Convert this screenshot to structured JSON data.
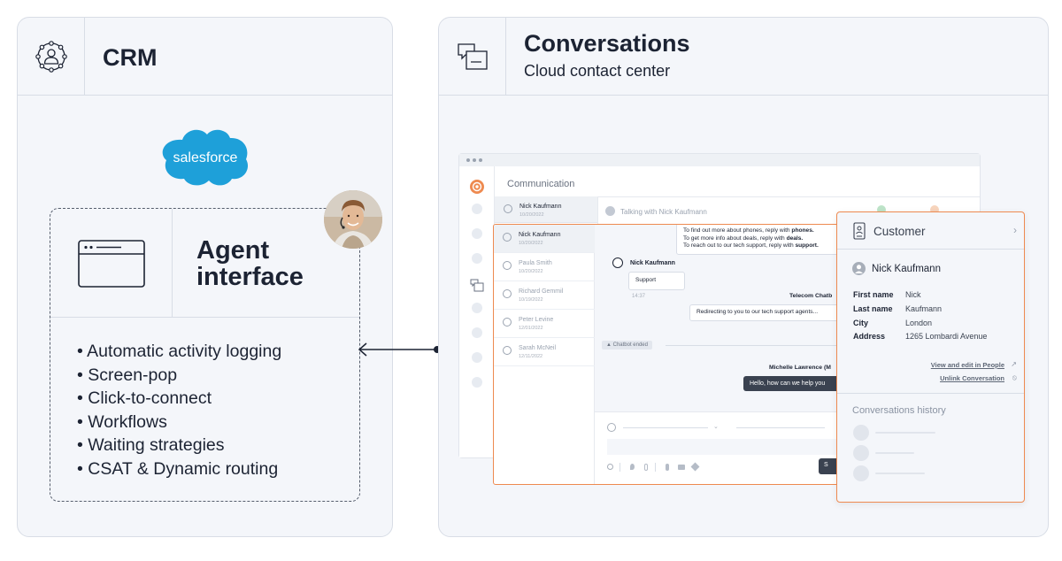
{
  "crm_panel": {
    "title": "CRM",
    "logo_text": "salesforce",
    "agent_interface": {
      "title_line1": "Agent",
      "title_line2": "interface",
      "features": [
        "Automatic activity logging",
        "Screen-pop",
        "Click-to-connect",
        "Workflows",
        "Waiting strategies",
        "CSAT & Dynamic routing"
      ]
    }
  },
  "conversations_panel": {
    "title": "Conversations",
    "subtitle": "Cloud contact center",
    "app": {
      "section_title": "Communication",
      "talking_with": "Talking with Nick Kaufmann",
      "back_contact": {
        "name": "Nick Kaufmann",
        "date": "10/20/2022"
      },
      "contacts": [
        {
          "name": "Nick Kaufmann",
          "date": "10/20/2022"
        },
        {
          "name": "Paula Smith",
          "date": "10/20/2022"
        },
        {
          "name": "Richard Gemmil",
          "date": "10/19/2022"
        },
        {
          "name": "Peter Levine",
          "date": "12/01/2022"
        },
        {
          "name": "Sarah McNeil",
          "date": "12/11/2022"
        }
      ],
      "chat": {
        "bot_lines": [
          {
            "pre": "To find out more about phones, reply with ",
            "keyword": "phones."
          },
          {
            "pre": "To get more info about deals, reply with ",
            "keyword": "deals."
          },
          {
            "pre": "To reach out to our tech support, reply with ",
            "keyword": "support."
          }
        ],
        "customer_name": "Nick Kaufmann",
        "customer_message": "Support",
        "message_time": "14:37",
        "bot_name": "Telecom Chatb",
        "bot_message": "Redirecting to you to our tech support agents...",
        "chatbot_ended": "Chatbot ended",
        "agent_name": "Michelle Lawrence (M",
        "agent_message": "Hello, how can we help you"
      },
      "send_button_label": "S"
    },
    "customer_card": {
      "title": "Customer",
      "name": "Nick Kaufmann",
      "fields": [
        {
          "label": "First name",
          "value": "Nick"
        },
        {
          "label": "Last name",
          "value": "Kaufmann"
        },
        {
          "label": "City",
          "value": "London"
        },
        {
          "label": "Address",
          "value": "1265 Lombardi Avenue"
        }
      ],
      "view_link": "View and edit in People",
      "unlink_link": "Unlink Conversation",
      "history_title": "Conversations history"
    }
  },
  "colors": {
    "accent_orange": "#ee8a50",
    "salesforce_blue": "#1ea0d9",
    "panel_bg": "#f4f6fa",
    "text_dark": "#1c2333"
  }
}
